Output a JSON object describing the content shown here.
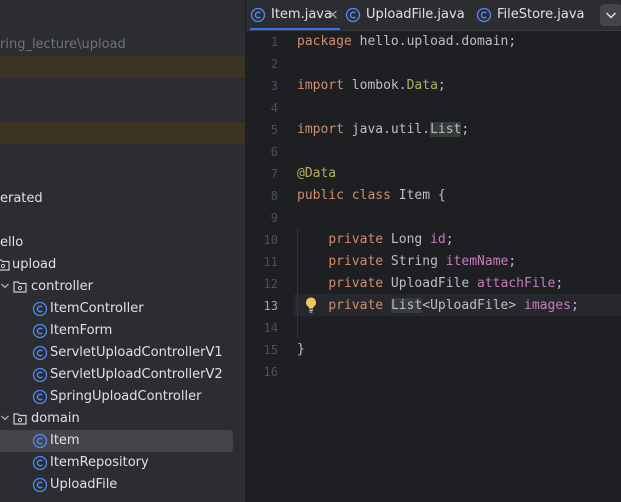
{
  "sidebar": {
    "path_fragment": "ring_lecture\\upload",
    "generated_fragment": "erated",
    "tree": [
      {
        "label": "ello",
        "kind": "text"
      },
      {
        "label": "upload",
        "kind": "folder"
      },
      {
        "label": "controller",
        "kind": "folder",
        "expanded": true
      },
      {
        "label": "ItemController",
        "kind": "class"
      },
      {
        "label": "ItemForm",
        "kind": "class"
      },
      {
        "label": "ServletUploadControllerV1",
        "kind": "class"
      },
      {
        "label": "ServletUploadControllerV2",
        "kind": "class"
      },
      {
        "label": "SpringUploadController",
        "kind": "class"
      },
      {
        "label": "domain",
        "kind": "folder",
        "expanded": true
      },
      {
        "label": "Item",
        "kind": "class",
        "selected": true
      },
      {
        "label": "ItemRepository",
        "kind": "class"
      },
      {
        "label": "UploadFile",
        "kind": "class"
      }
    ]
  },
  "tabs": [
    {
      "label": "Item.java",
      "active": true,
      "close": "×"
    },
    {
      "label": "UploadFile.java",
      "active": false
    },
    {
      "label": "FileStore.java",
      "active": false
    }
  ],
  "editor": {
    "current_line": 13,
    "line_numbers": [
      "1",
      "2",
      "3",
      "4",
      "5",
      "6",
      "7",
      "8",
      "9",
      "10",
      "11",
      "12",
      "13",
      "14",
      "15",
      "16"
    ],
    "code": {
      "l1_kw": "package",
      "l1_rest": " hello.upload.domain;",
      "l3_kw": "import",
      "l3_a": " lombok.",
      "l3_b": "Data",
      "l3_c": ";",
      "l5_kw": "import",
      "l5_a": " java.util.",
      "l5_b": "List",
      "l5_c": ";",
      "l7_ann": "@Data",
      "l8_kw": "public class",
      "l8_rest": " Item {",
      "l10_kw": "private",
      "l10_type": " Long ",
      "l10_field": "id",
      "l10_end": ";",
      "l11_kw": "private",
      "l11_type": " String ",
      "l11_field": "itemName",
      "l11_end": ";",
      "l12_kw": "private",
      "l12_type": " UploadFile ",
      "l12_field": "attachFile",
      "l12_end": ";",
      "l13_kw": "private",
      "l13_type1": "List",
      "l13_type2": "<UploadFile> ",
      "l13_field": "images",
      "l13_end": ";",
      "l15": "}"
    }
  },
  "colors": {
    "keyword": "#cf8e6d",
    "annotation": "#b3ae60",
    "field": "#c77dbb",
    "accent": "#3574f0",
    "class_icon": "#548af7"
  },
  "icons": {
    "class": "class-c-icon",
    "folder": "package-folder-icon",
    "more": "chevron-down-icon",
    "hint": "lightbulb-icon"
  }
}
